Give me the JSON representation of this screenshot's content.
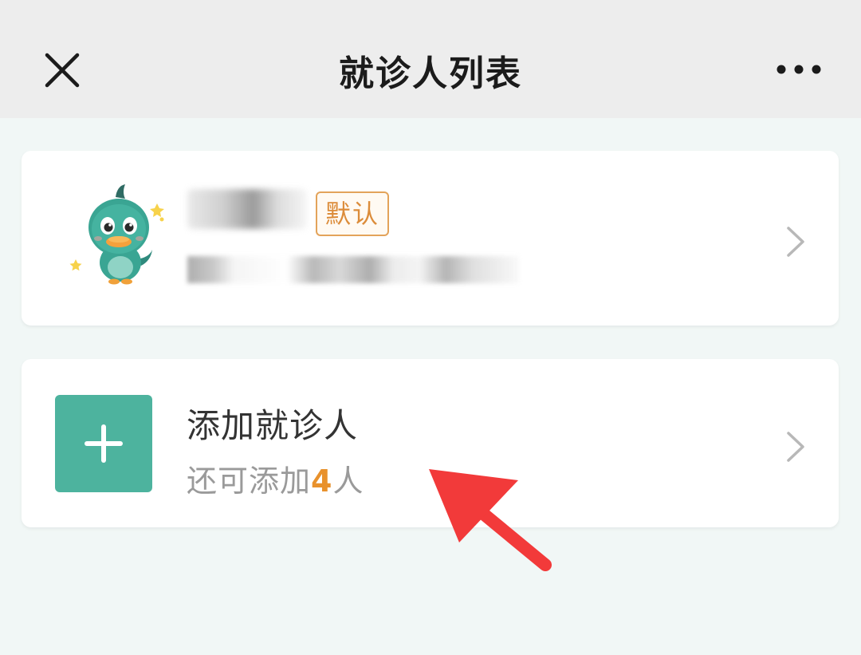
{
  "header": {
    "title": "就诊人列表",
    "close_icon": "close-icon",
    "more_icon": "more-icon"
  },
  "patient_card": {
    "avatar_icon": "duck-avatar-icon",
    "default_badge": "默认",
    "chevron_icon": "chevron-right-icon"
  },
  "add_card": {
    "plus_icon": "plus-icon",
    "title": "添加就诊人",
    "subtitle_prefix": "还可添加",
    "remaining_count": "4",
    "subtitle_suffix": "人",
    "chevron_icon": "chevron-right-icon"
  },
  "annotation": {
    "arrow_icon": "red-arrow-icon"
  },
  "colors": {
    "accent_green": "#4db39e",
    "badge_orange": "#dc8c3a",
    "count_orange": "#e8912c",
    "arrow_red": "#f23a3a"
  }
}
